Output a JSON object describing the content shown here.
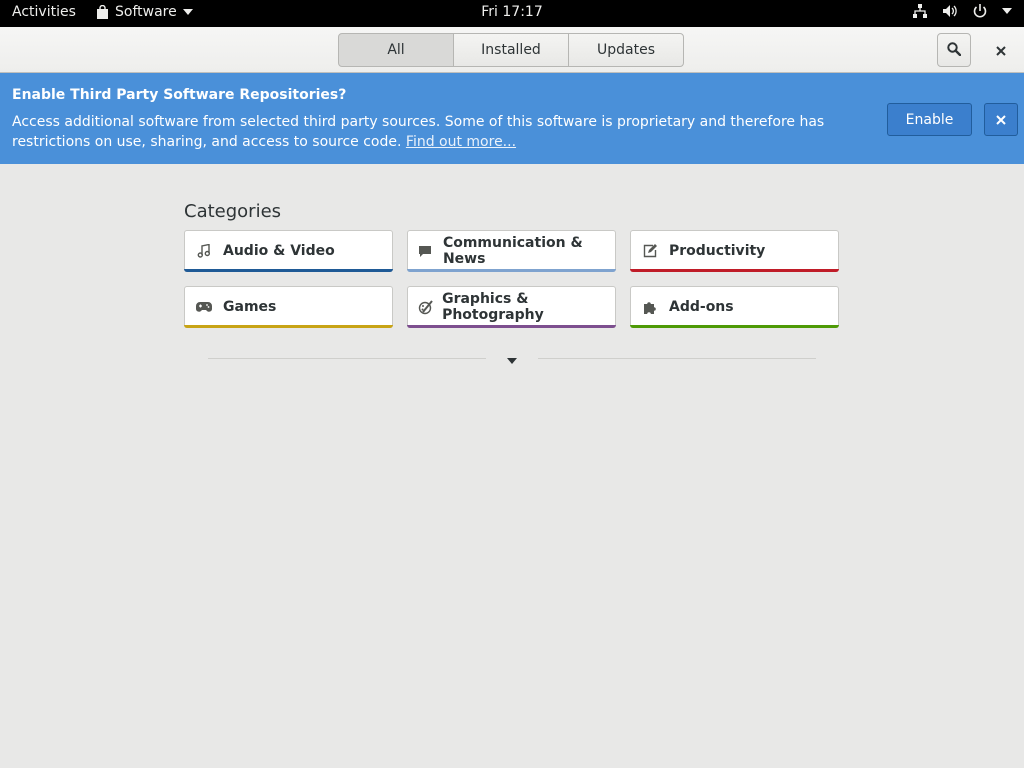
{
  "topbar": {
    "activities_label": "Activities",
    "app_name": "Software",
    "clock": "Fri 17:17"
  },
  "header": {
    "tabs": [
      {
        "label": "All",
        "active": true
      },
      {
        "label": "Installed",
        "active": false
      },
      {
        "label": "Updates",
        "active": false
      }
    ]
  },
  "infobar": {
    "title": "Enable Third Party Software Repositories?",
    "message": "Access additional software from selected third party sources. Some of this software is proprietary and therefore has restrictions on use, sharing, and access to source code.",
    "link_text": "Find out more...",
    "enable_label": "Enable",
    "color": "#4a90d9"
  },
  "categories": {
    "title": "Categories",
    "items": [
      {
        "label": "Audio & Video",
        "icon": "music-note-icon",
        "color": "#1f5a96"
      },
      {
        "label": "Communication & News",
        "icon": "chat-bubble-icon",
        "color": "#7fa3cf"
      },
      {
        "label": "Productivity",
        "icon": "edit-icon",
        "color": "#c01c28"
      },
      {
        "label": "Games",
        "icon": "gamepad-icon",
        "color": "#c8a416"
      },
      {
        "label": "Graphics & Photography",
        "icon": "palette-icon",
        "color": "#7d4f8f"
      },
      {
        "label": "Add-ons",
        "icon": "puzzle-piece-icon",
        "color": "#4e9a06"
      }
    ]
  }
}
